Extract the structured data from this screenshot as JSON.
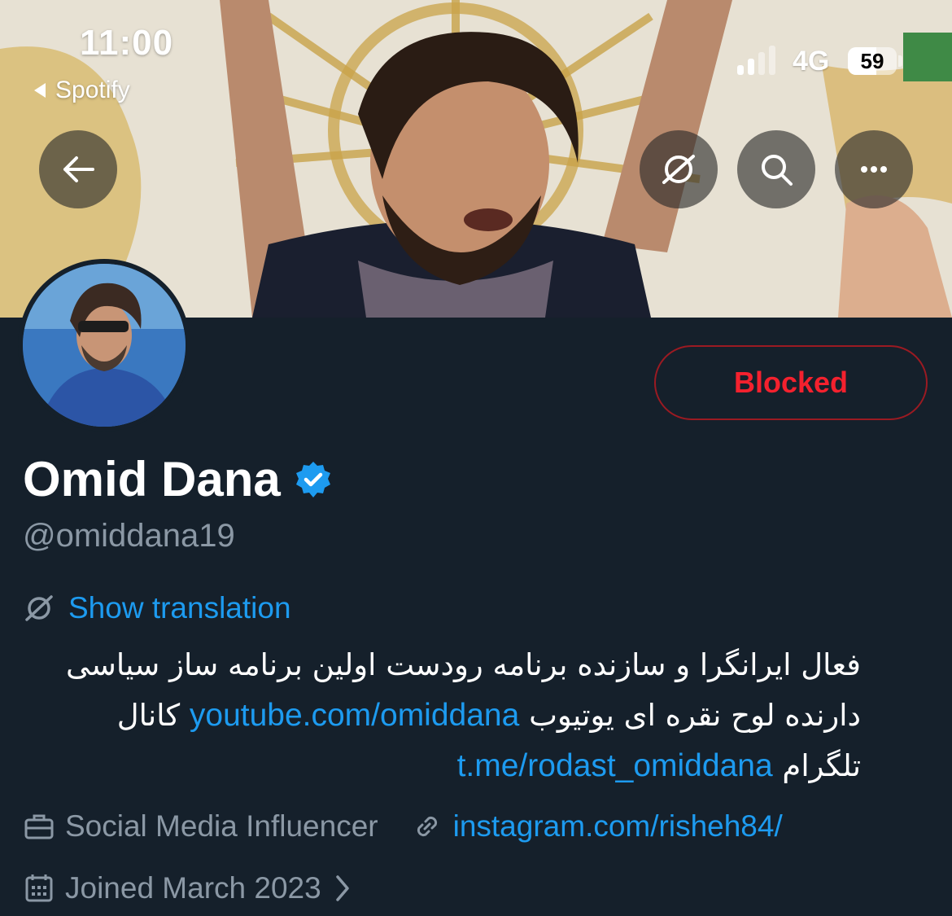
{
  "status_bar": {
    "time": "11:00",
    "back_app": "Spotify",
    "network": "4G",
    "battery_level": "59",
    "battery_fraction": 0.59
  },
  "header_actions": {
    "back_icon": "arrow-left-icon",
    "translate_icon": "translate-globe-icon",
    "search_icon": "search-icon",
    "more_icon": "more-horizontal-icon"
  },
  "profile": {
    "display_name": "Omid Dana",
    "verified_icon": "verified-badge-icon",
    "handle": "@omiddana19",
    "relationship_button": "Blocked"
  },
  "translation": {
    "icon": "translate-globe-icon",
    "label": "Show translation"
  },
  "bio": {
    "line1": "فعال ایرانگرا و سازنده برنامه رودست اولین برنامه ساز سیاسی",
    "line2_prefix": "دارنده لوح نقره ای یوتیوب",
    "youtube_link": "youtube.com/omiddana",
    "line2_suffix": "کانال",
    "telegram_link": "t.me/rodast_omiddana",
    "line3_suffix": "تلگرام"
  },
  "meta": {
    "category_icon": "briefcase-icon",
    "category": "Social Media Influencer",
    "link_icon": "link-icon",
    "website": "instagram.com/risheh84/",
    "joined_icon": "calendar-icon",
    "joined": "Joined March 2023",
    "joined_chevron": "chevron-right-icon"
  },
  "colors": {
    "background": "#15202b",
    "accent_blue": "#1d9bf0",
    "blocked_red": "#f4212e",
    "secondary_text": "#8b98a5"
  }
}
